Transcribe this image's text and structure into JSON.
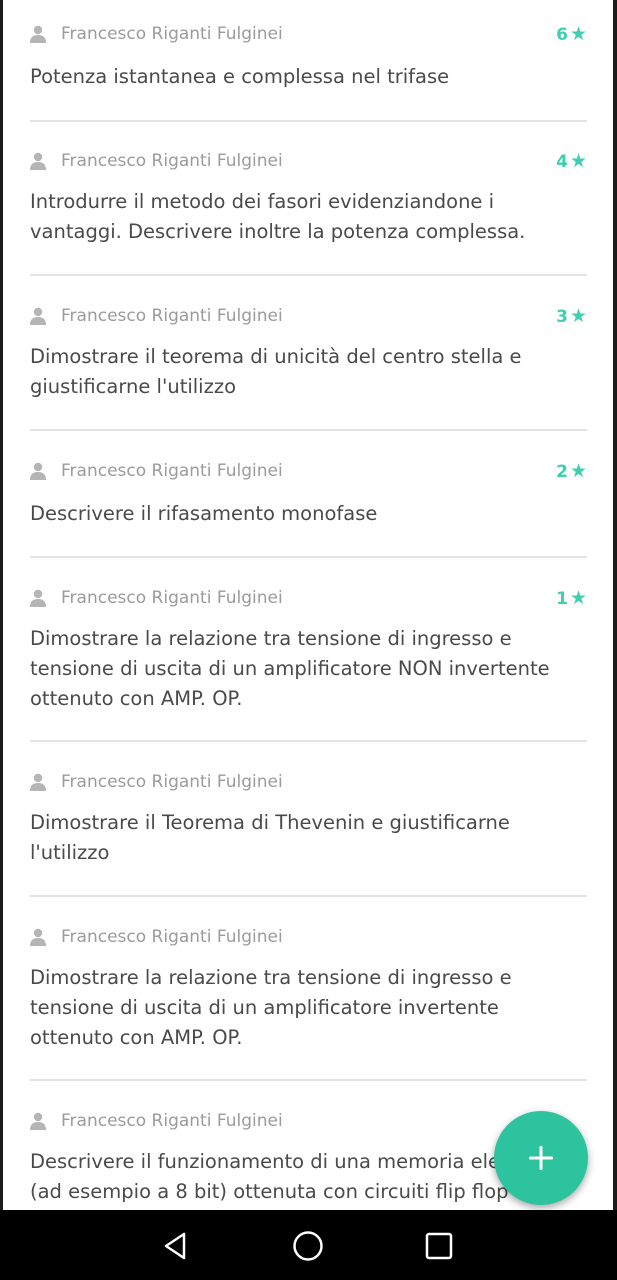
{
  "questions": [
    {
      "author": "Francesco Riganti Fulginei",
      "rating": "6",
      "text": "Potenza istantanea e complessa nel trifase"
    },
    {
      "author": "Francesco Riganti Fulginei",
      "rating": "4",
      "text": "Introdurre il metodo dei fasori evidenziandone i vantaggi. Descrivere inoltre la potenza complessa."
    },
    {
      "author": "Francesco Riganti Fulginei",
      "rating": "3",
      "text": "Dimostrare il teorema di unicità del centro stella e giustificarne l'utilizzo"
    },
    {
      "author": "Francesco Riganti Fulginei",
      "rating": "2",
      "text": "Descrivere il rifasamento monofase"
    },
    {
      "author": "Francesco Riganti Fulginei",
      "rating": "1",
      "text": "Dimostrare la relazione tra tensione di ingresso e tensione di uscita di un amplificatore NON invertente ottenuto con AMP. OP."
    },
    {
      "author": "Francesco Riganti Fulginei",
      "rating": "",
      "text": "Dimostrare il Teorema di Thevenin e giustificarne l'utilizzo"
    },
    {
      "author": "Francesco Riganti Fulginei",
      "rating": "",
      "text": "Dimostrare la relazione tra tensione di ingresso e tensione di uscita di un amplificatore invertente ottenuto con AMP. OP."
    },
    {
      "author": "Francesco Riganti Fulginei",
      "rating": "",
      "text": "Descrivere il funzionamento di una memoria elettronica (ad esempio a 8 bit) ottenuta con circuiti flip flop"
    }
  ],
  "colors": {
    "accent": "#2cc39e",
    "rating": "#3fcfb0",
    "author": "#9b9b9b",
    "text": "#4a4a4a",
    "divider": "#e3e3e3"
  },
  "icons": {
    "author": "person-icon",
    "rating": "star-icon",
    "fab": "plus-icon",
    "nav": [
      "back-icon",
      "home-icon",
      "recents-icon"
    ]
  }
}
